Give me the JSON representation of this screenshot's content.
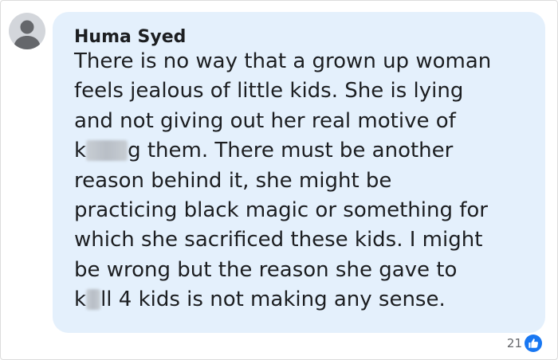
{
  "comment": {
    "author": "Huma Syed",
    "lines": [
      {
        "text": "There is no way that a grown up woman"
      },
      {
        "text": "feels jealous of little kids. She is lying"
      },
      {
        "text": "and not giving out her real motive of"
      },
      {
        "before": "k",
        "after": "g them. There must be another"
      },
      {
        "text": "reason behind it, she might be"
      },
      {
        "text": "practicing black magic or something for"
      },
      {
        "text": "which she sacrificed these kids. I might"
      },
      {
        "text": "be wrong but the reason she gave to"
      },
      {
        "before": "k",
        "after": "ll 4 kids is not making any sense."
      }
    ],
    "reaction_count": "21",
    "reaction_icon": "like-icon",
    "colors": {
      "bubble": "#e4f0fc",
      "text": "#1c1e21",
      "like": "#1877f2",
      "muted": "#65676b"
    }
  }
}
